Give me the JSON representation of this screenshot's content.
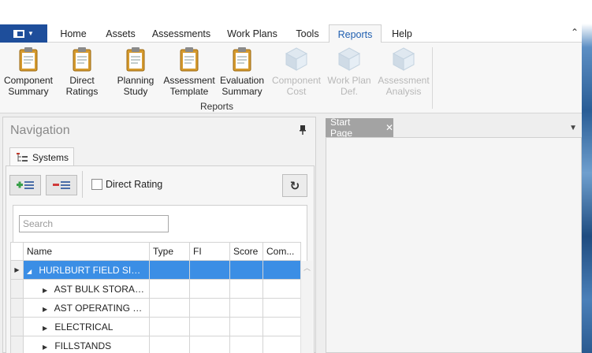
{
  "menu": {
    "tabs": [
      {
        "label": "Home"
      },
      {
        "label": "Assets"
      },
      {
        "label": "Assessments"
      },
      {
        "label": "Work Plans"
      },
      {
        "label": "Tools"
      },
      {
        "label": "Reports"
      },
      {
        "label": "Help"
      }
    ],
    "active_tab": "Reports",
    "collapse_icon": "chevron-up-icon"
  },
  "ribbon": {
    "buttons": [
      {
        "line1": "Component",
        "line2": "Summary",
        "icon": "clipboard-icon",
        "enabled": true
      },
      {
        "line1": "Direct",
        "line2": "Ratings",
        "icon": "clipboard-icon",
        "enabled": true
      },
      {
        "line1": "Planning",
        "line2": "Study",
        "icon": "clipboard-icon",
        "enabled": true
      },
      {
        "line1": "Assessment",
        "line2": "Template",
        "icon": "clipboard-icon",
        "enabled": true
      },
      {
        "line1": "Evaluation",
        "line2": "Summary",
        "icon": "clipboard-icon",
        "enabled": true
      },
      {
        "line1": "Component",
        "line2": "Cost",
        "icon": "cube-icon",
        "enabled": false
      },
      {
        "line1": "Work Plan",
        "line2": "Def.",
        "icon": "cube-icon",
        "enabled": false
      },
      {
        "line1": "Assessment",
        "line2": "Analysis",
        "icon": "cube-icon",
        "enabled": false
      }
    ],
    "group_label": "Reports"
  },
  "navigation": {
    "title": "Navigation",
    "tab_label": "Systems",
    "direct_rating_label": "Direct Rating",
    "direct_rating_checked": false,
    "search": {
      "placeholder": "Search",
      "value": ""
    },
    "columns": [
      "Name",
      "Type",
      "FI",
      "Score",
      "Com..."
    ],
    "rows": [
      {
        "name": "HURLBURT FIELD SITE...",
        "selected": true,
        "expanded": true,
        "level": 0
      },
      {
        "name": "AST BULK STORAGE",
        "selected": false,
        "expanded": false,
        "level": 1
      },
      {
        "name": "AST OPERATING ST...",
        "selected": false,
        "expanded": false,
        "level": 1
      },
      {
        "name": "ELECTRICAL",
        "selected": false,
        "expanded": false,
        "level": 1
      },
      {
        "name": "FILLSTANDS",
        "selected": false,
        "expanded": false,
        "level": 1
      }
    ],
    "selection_color": "#3b8ee5"
  },
  "documents": {
    "tabs": [
      {
        "label": "Start Page"
      }
    ]
  },
  "colors": {
    "file_button": "#1e4e9b",
    "active_tab_text": "#1f5fb0",
    "doc_tab": "#a3a3a3"
  }
}
